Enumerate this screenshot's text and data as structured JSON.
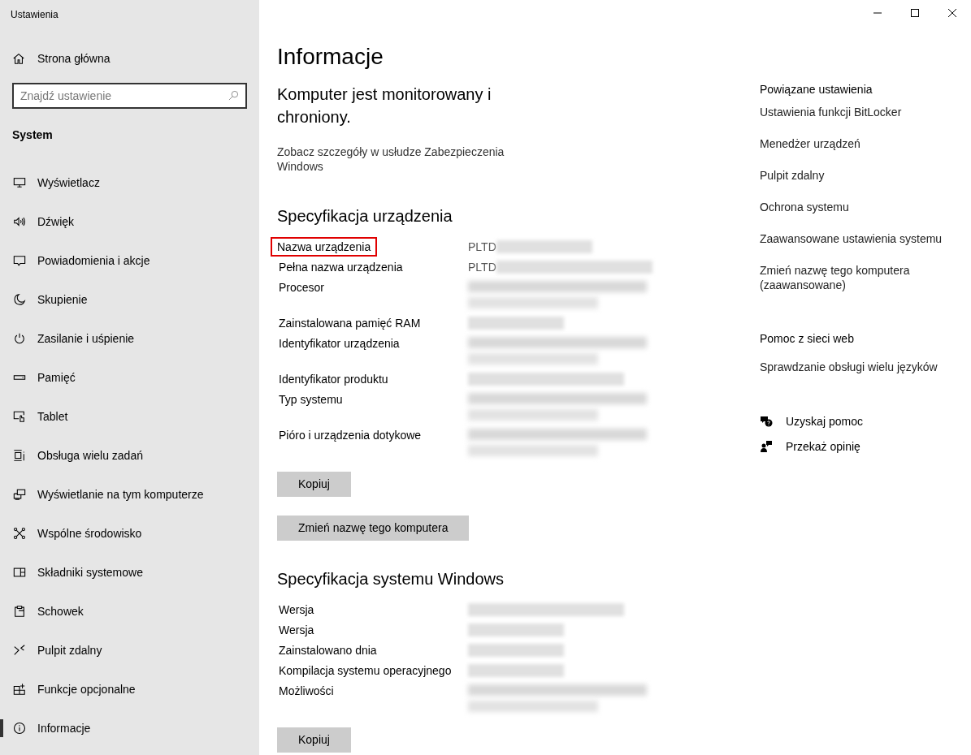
{
  "window": {
    "title": "Ustawienia"
  },
  "sidebar": {
    "home": "Strona główna",
    "search": {
      "placeholder": "Znajdź ustawienie"
    },
    "section": "System",
    "items": [
      {
        "label": "Wyświetlacz",
        "kind": "monitor",
        "selected": false
      },
      {
        "label": "Dźwięk",
        "kind": "speaker",
        "selected": false
      },
      {
        "label": "Powiadomienia i akcje",
        "kind": "message",
        "selected": false
      },
      {
        "label": "Skupienie",
        "kind": "moon",
        "selected": false
      },
      {
        "label": "Zasilanie i uśpienie",
        "kind": "power",
        "selected": false
      },
      {
        "label": "Pamięć",
        "kind": "drive",
        "selected": false
      },
      {
        "label": "Tablet",
        "kind": "tablet",
        "selected": false
      },
      {
        "label": "Obsługa wielu zadań",
        "kind": "multitask",
        "selected": false
      },
      {
        "label": "Wyświetlanie na tym komputerze",
        "kind": "project",
        "selected": false
      },
      {
        "label": "Wspólne środowisko",
        "kind": "share",
        "selected": false
      },
      {
        "label": "Składniki systemowe",
        "kind": "components",
        "selected": false
      },
      {
        "label": "Schowek",
        "kind": "clipboard",
        "selected": false
      },
      {
        "label": "Pulpit zdalny",
        "kind": "remote",
        "selected": false
      },
      {
        "label": "Funkcje opcjonalne",
        "kind": "optional",
        "selected": false
      },
      {
        "label": "Informacje",
        "kind": "info",
        "selected": true
      }
    ]
  },
  "main": {
    "title": "Informacje",
    "security_status": "Komputer jest monitorowany i chroniony.",
    "security_link": "Zobacz szczegóły w usłudze Zabezpieczenia Windows",
    "device_specs": {
      "heading": "Specyfikacja urządzenia",
      "rows": [
        {
          "label": "Nazwa urządzenia",
          "value": "PLTD",
          "kind": "short",
          "highlighted": true
        },
        {
          "label": "Pełna nazwa urządzenia",
          "value": "PLTD",
          "kind": "long",
          "highlighted": false
        },
        {
          "label": "Procesor",
          "kind": "double",
          "highlighted": false
        },
        {
          "label": "Zainstalowana pamięć RAM",
          "kind": "short",
          "highlighted": false
        },
        {
          "label": "Identyfikator urządzenia",
          "kind": "double",
          "highlighted": false
        },
        {
          "label": "Identyfikator produktu",
          "kind": "long",
          "highlighted": false
        },
        {
          "label": "Typ systemu",
          "kind": "double",
          "highlighted": false
        },
        {
          "label": "Pióro i urządzenia dotykowe",
          "kind": "double",
          "highlighted": false
        }
      ],
      "buttons": [
        "Kopiuj",
        "Zmień nazwę tego komputera"
      ]
    },
    "windows_specs": {
      "heading": "Specyfikacja systemu Windows",
      "rows": [
        {
          "label": "Wersja",
          "kind": "long",
          "highlighted": false
        },
        {
          "label": "Wersja",
          "kind": "short",
          "highlighted": false
        },
        {
          "label": "Zainstalowano dnia",
          "kind": "short",
          "highlighted": false
        },
        {
          "label": "Kompilacja systemu operacyjnego",
          "kind": "short",
          "highlighted": false
        },
        {
          "label": "Możliwości",
          "kind": "double",
          "highlighted": false
        }
      ],
      "buttons": [
        "Kopiuj"
      ]
    }
  },
  "related": {
    "heading": "Powiązane ustawienia",
    "links": [
      "Ustawienia funkcji BitLocker",
      "Menedżer urządzeń",
      "Pulpit zdalny",
      "Ochrona systemu",
      "Zaawansowane ustawienia systemu",
      "Zmień nazwę tego komputera (zaawansowane)"
    ]
  },
  "web_help": {
    "heading": "Pomoc z sieci web",
    "links": [
      "Sprawdzanie obsługi wielu języków"
    ]
  },
  "support": [
    {
      "label": "Uzyskaj pomoc",
      "kind": "help"
    },
    {
      "label": "Przekaż opinię",
      "kind": "feedback"
    }
  ]
}
